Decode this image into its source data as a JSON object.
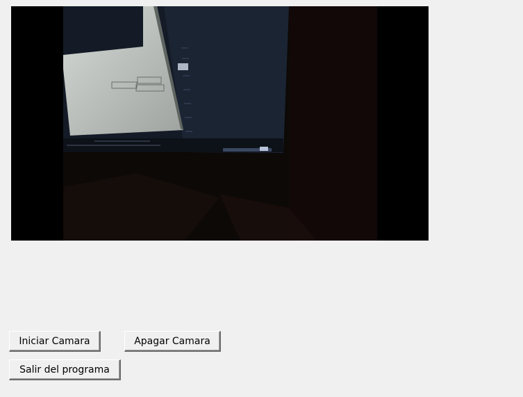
{
  "video": {
    "screen_bg": "#1f2a3a",
    "paper_color": "#c8ccc8"
  },
  "buttons": {
    "start_label": "Iniciar Camara",
    "stop_label": "Apagar Camara",
    "exit_label": "Salir del programa"
  }
}
